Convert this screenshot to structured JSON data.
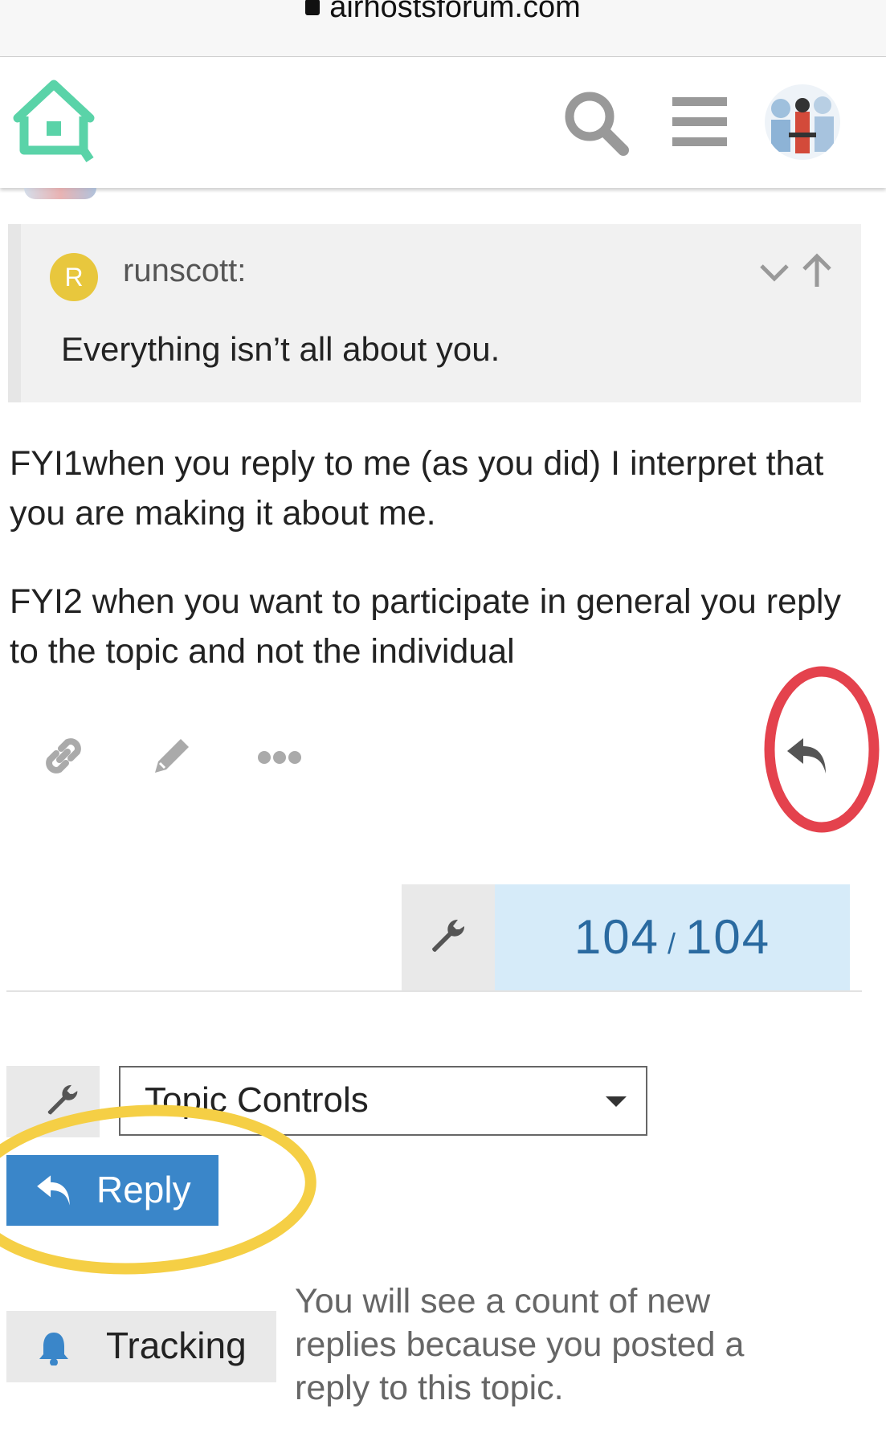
{
  "browser": {
    "url": "airhostsforum.com"
  },
  "header": {
    "logo_icon": "house-icon",
    "search_icon": "search-icon",
    "menu_icon": "hamburger-icon",
    "avatar_icon": "user-avatar"
  },
  "quote": {
    "avatar_letter": "R",
    "avatar_color": "#e8c73d",
    "username": "runscott:",
    "text": "Everything isn’t all about you."
  },
  "post": {
    "paragraph_1": "FYI1when you reply to me (as you did) I interpret that you are making it about me.",
    "paragraph_2": "FYI2 when you want to participate in general you reply to the topic and not the individual"
  },
  "post_actions": {
    "link_icon": "link-icon",
    "edit_icon": "pencil-icon",
    "more_icon": "ellipsis-icon",
    "reply_icon": "reply-arrow-icon"
  },
  "progress": {
    "current": "104",
    "separator": "/",
    "total": "104",
    "accent": "#2a6aa0"
  },
  "topic_controls": {
    "label": "Topic Controls"
  },
  "reply_button": {
    "label": "Reply",
    "color": "#3a86c9"
  },
  "tracking": {
    "label": "Tracking",
    "description": "You will see a count of new replies because you posted a reply to this topic."
  },
  "annotations": {
    "red_circle_color": "#e4424d",
    "yellow_circle_color": "#f5cf45"
  }
}
